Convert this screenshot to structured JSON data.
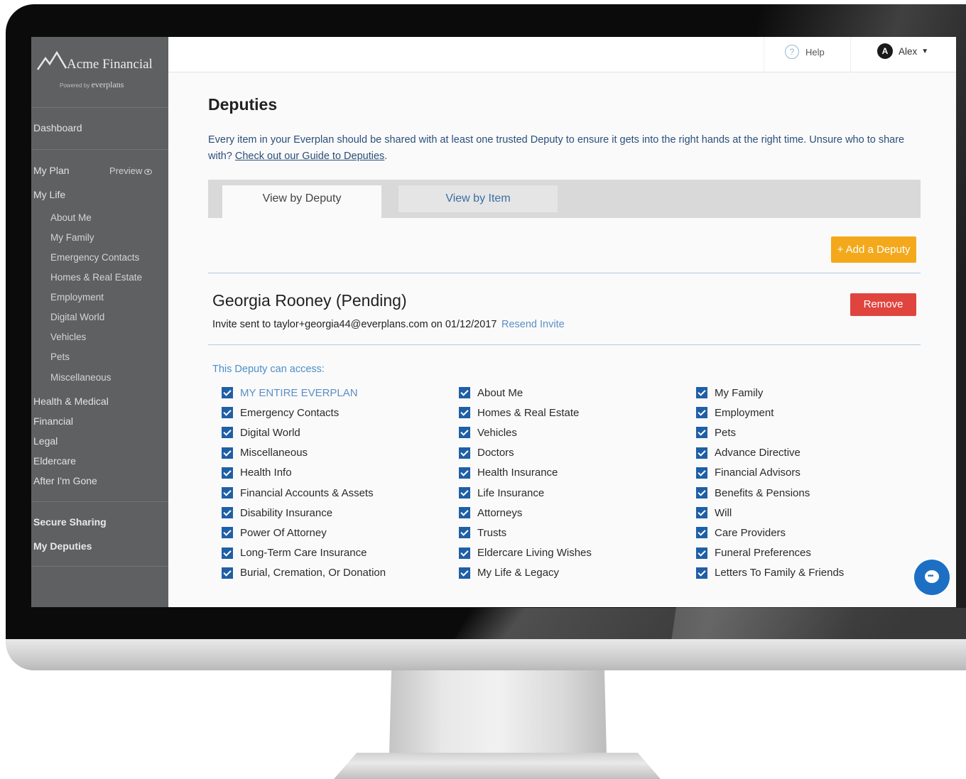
{
  "brand": {
    "name": "Acme Financial",
    "powered_by_prefix": "Powered by",
    "powered_by_name": "everplans"
  },
  "header": {
    "help_label": "Help",
    "user_initial": "A",
    "user_name": "Alex"
  },
  "sidebar": {
    "dashboard": "Dashboard",
    "my_plan": "My Plan",
    "preview": "Preview",
    "my_life": "My Life",
    "my_life_items": [
      "About Me",
      "My Family",
      "Emergency Contacts",
      "Homes & Real Estate",
      "Employment",
      "Digital World",
      "Vehicles",
      "Pets",
      "Miscellaneous"
    ],
    "sections": [
      "Health & Medical",
      "Financial",
      "Legal",
      "Eldercare",
      "After I'm Gone"
    ],
    "secure_sharing": "Secure Sharing",
    "my_deputies": "My Deputies"
  },
  "main": {
    "title": "Deputies",
    "intro_text": "Every item in your Everplan should be shared with at least one trusted Deputy to ensure it gets into the right hands at the right time. Unsure who to share with?",
    "intro_link": "Check out our Guide to Deputies",
    "intro_end": ".",
    "tabs": [
      "View by Deputy",
      "View by Item"
    ],
    "add_deputy": "+ Add a Deputy",
    "deputy": {
      "name": "Georgia Rooney (Pending)",
      "invite_text": "Invite sent to taylor+georgia44@everplans.com on 01/12/2017",
      "resend": "Resend Invite",
      "remove": "Remove",
      "access_label": "This Deputy can access:"
    },
    "access_columns": [
      [
        "MY ENTIRE EVERPLAN",
        "Emergency Contacts",
        "Digital World",
        "Miscellaneous",
        "Health Info",
        "Financial Accounts & Assets",
        "Disability Insurance",
        "Power Of Attorney",
        "Long-Term Care Insurance",
        "Burial, Cremation, Or Donation"
      ],
      [
        "About Me",
        "Homes & Real Estate",
        "Vehicles",
        "Doctors",
        "Health Insurance",
        "Life Insurance",
        "Attorneys",
        "Trusts",
        "Eldercare Living Wishes",
        "My Life & Legacy"
      ],
      [
        "My Family",
        "Employment",
        "Pets",
        "Advance Directive",
        "Financial Advisors",
        "Benefits & Pensions",
        "Will",
        "Care Providers",
        "Funeral Preferences",
        "Letters To Family & Friends"
      ]
    ]
  },
  "colors": {
    "sidebar_bg": "#5f6061",
    "add_button": "#f3a91b",
    "remove_button": "#e0443e",
    "checkbox": "#1f5fa6",
    "link": "#5b8fc5",
    "chat_button": "#1d6fc4"
  },
  "icons": [
    "mountain-logo-icon",
    "help-icon",
    "avatar",
    "chevron-down-icon",
    "eye-icon",
    "checkbox-checked-icon",
    "chat-icon"
  ]
}
